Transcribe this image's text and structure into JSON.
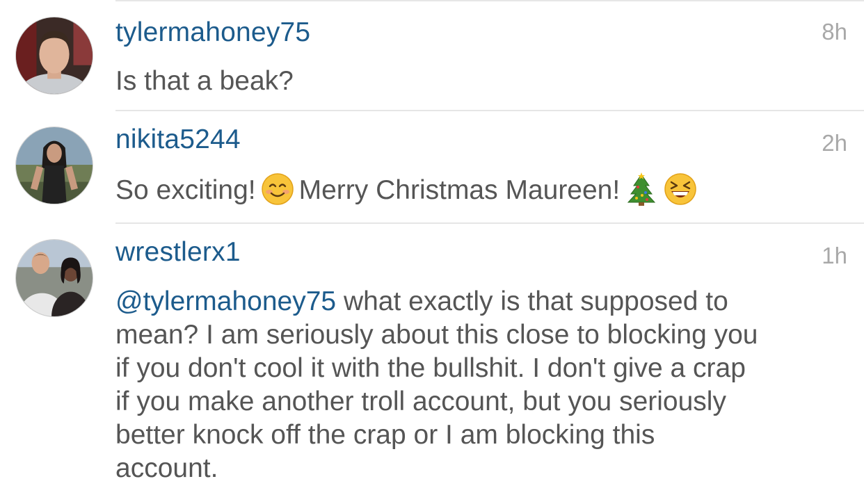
{
  "comments": [
    {
      "username": "tylermahoney75",
      "time": "8h",
      "text": "Is that a beak?"
    },
    {
      "username": "nikita5244",
      "time": "2h",
      "text_part1": "So exciting!",
      "text_part2": "Merry Christmas Maureen!",
      "emojis": [
        "smiling-face-emoji",
        "christmas-tree-emoji",
        "laughing-face-emoji"
      ]
    },
    {
      "username": "wrestlerx1",
      "time": "1h",
      "mention": "@tylermahoney75",
      "line1_rest": "what exactly is that supposed to",
      "line2": "mean? I am seriously about this close to blocking you",
      "line3": "if you don't cool it with the bullshit. I don't give a crap",
      "line4": "if you make another troll account, but you seriously",
      "line5": "better knock off the crap or I am blocking this",
      "line6": "account."
    }
  ],
  "colors": {
    "username": "#1c5b8c",
    "body_text": "#555555",
    "timestamp": "#a8a8a8",
    "divider": "#e6e6e6"
  }
}
